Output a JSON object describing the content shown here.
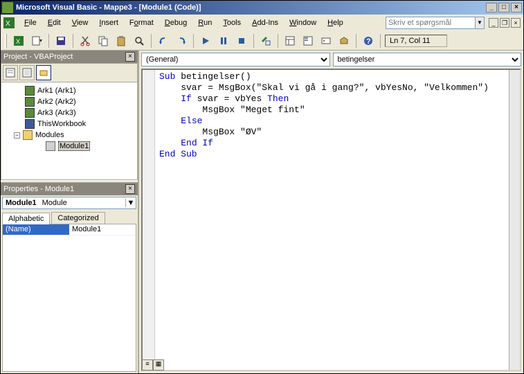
{
  "title": "Microsoft Visual Basic - Mappe3 - [Module1 (Code)]",
  "menu": {
    "file": "File",
    "edit": "Edit",
    "view": "View",
    "insert": "Insert",
    "format": "Format",
    "debug": "Debug",
    "run": "Run",
    "tools": "Tools",
    "addins": "Add-Ins",
    "window": "Window",
    "help": "Help"
  },
  "ask_placeholder": "Skriv et spørgsmål",
  "status_pos": "Ln 7, Col 11",
  "project_panel_title": "Project - VBAProject",
  "tree": {
    "ark1": "Ark1 (Ark1)",
    "ark2": "Ark2 (Ark2)",
    "ark3": "Ark3 (Ark3)",
    "thiswb": "ThisWorkbook",
    "modules": "Modules",
    "module1": "Module1"
  },
  "props_panel_title": "Properties - Module1",
  "props_obj_name": "Module1",
  "props_obj_type": "Module",
  "tabs": {
    "alpha": "Alphabetic",
    "cat": "Categorized"
  },
  "prop": {
    "name_key": "(Name)",
    "name_val": "Module1"
  },
  "selectors": {
    "left": "(General)",
    "right": "betingelser"
  },
  "code": {
    "l1a": "Sub",
    "l1b": " betingelser()",
    "l2": "    svar = MsgBox(\"Skal vi gå i gang?\", vbYesNo, \"Velkommen\")",
    "l3a": "    ",
    "l3b": "If",
    "l3c": " svar = vbYes ",
    "l3d": "Then",
    "l4": "        MsgBox \"Meget fint\"",
    "l5": "    ",
    "l5b": "Else",
    "l6": "        MsgBox \"ØV\"",
    "l7": "    ",
    "l7b": "End If",
    "l8": "End Sub"
  }
}
